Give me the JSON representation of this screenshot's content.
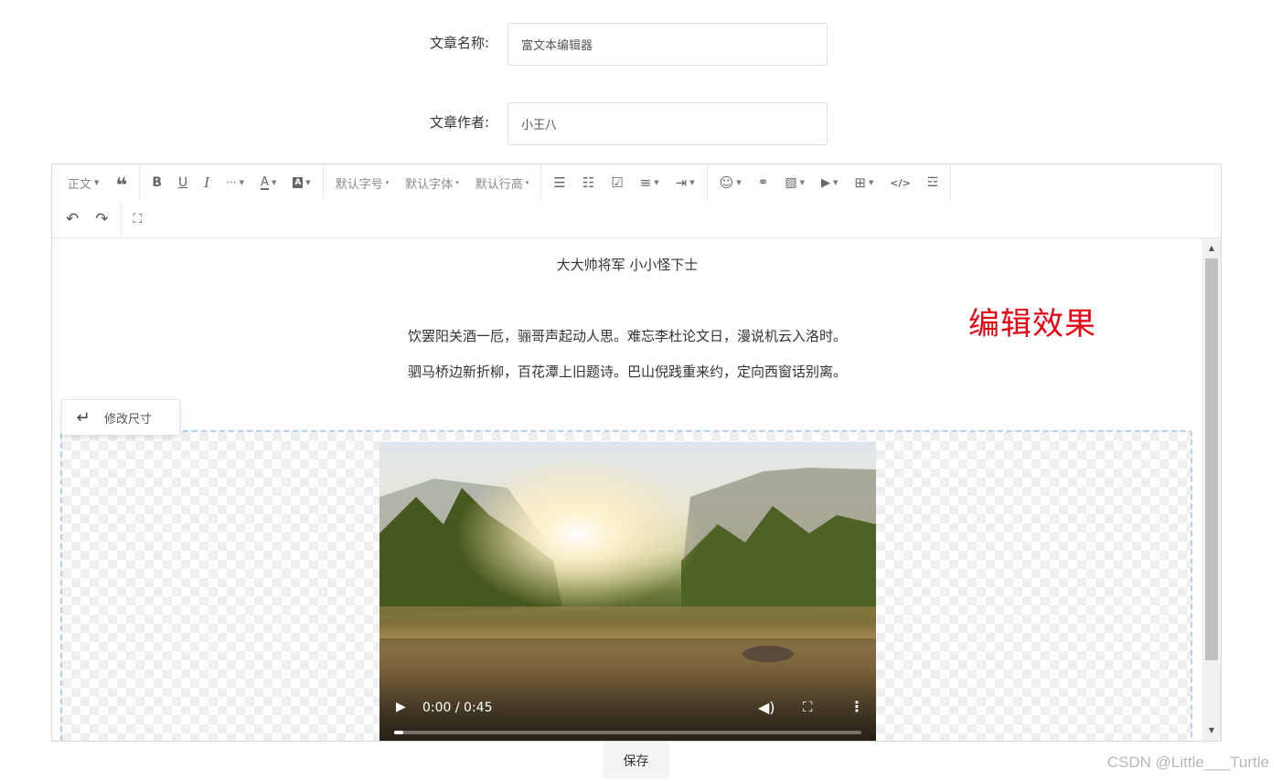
{
  "form": {
    "title_label": "文章名称:",
    "title_value": "富文本编辑器",
    "author_label": "文章作者:",
    "author_value": "小王八"
  },
  "toolbar": {
    "paragraph": "正文",
    "font_size": "默认字号",
    "font_family": "默认字体",
    "line_height": "默认行高"
  },
  "content": {
    "headline": "大大帅将军 小小怪下士",
    "poem": [
      "饮罢阳关酒一卮，骊哥声起动人思。难忘李杜论文日，漫说机云入洛时。",
      "驷马桥边新折柳，百花潭上旧题诗。巴山倪践重来约，定向西窗话别离。"
    ],
    "annotation": "编辑效果",
    "resize_label": "修改尺寸"
  },
  "video": {
    "time": "0:00 / 0:45",
    "progress": 0.02
  },
  "save_label": "保存",
  "watermark": "CSDN @Little___Turtle",
  "colors": {
    "annotation": "#e60012",
    "video_outline": "#b3cfee"
  }
}
